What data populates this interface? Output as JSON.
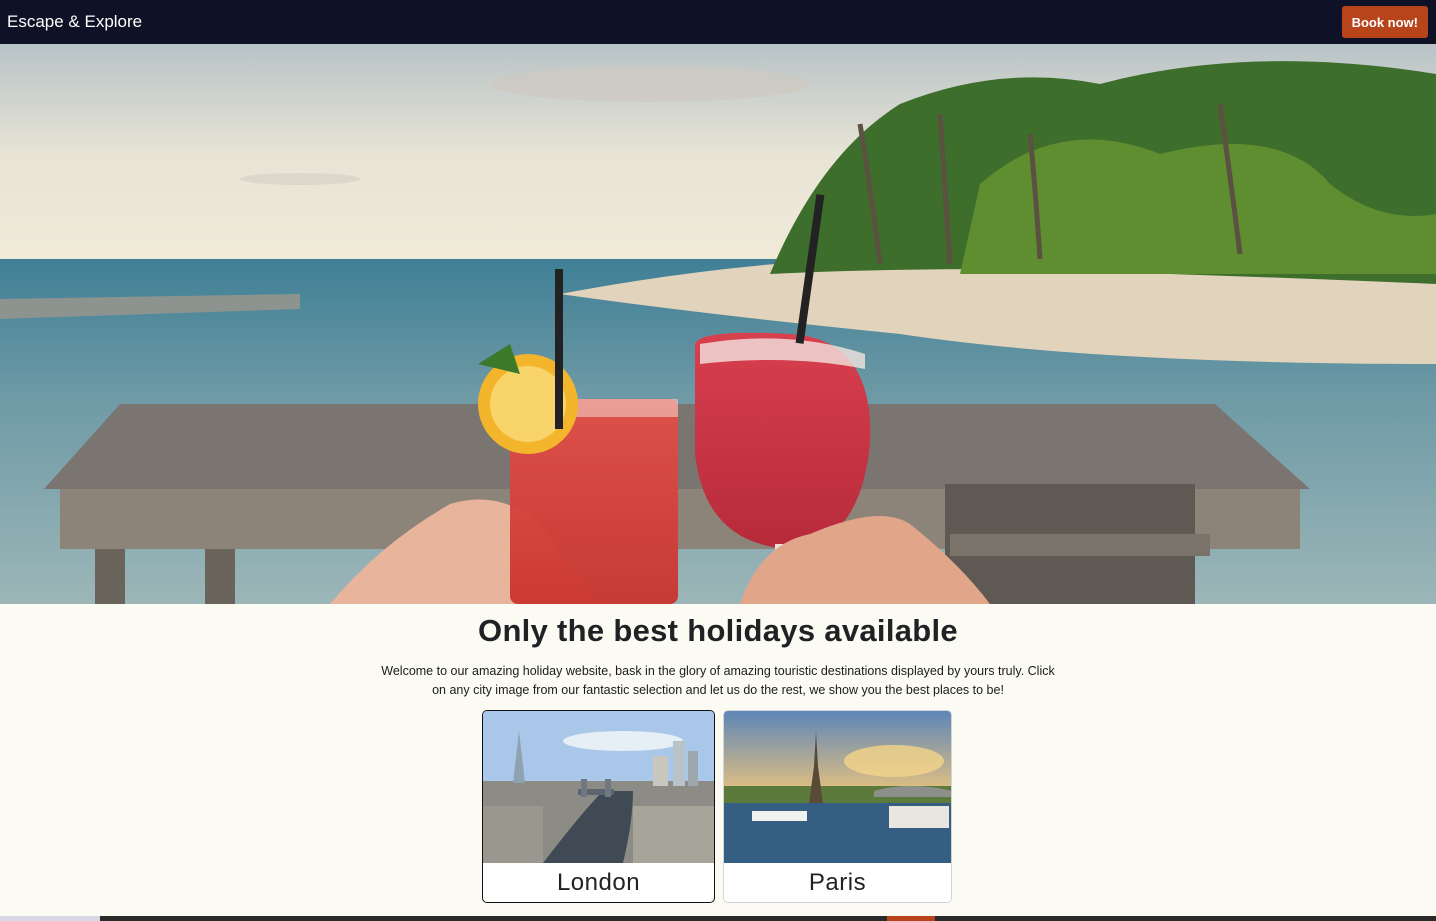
{
  "navbar": {
    "brand": "Escape & Explore",
    "cta_label": "Book now!"
  },
  "main": {
    "title": "Only the best holidays available",
    "intro": "Welcome to our amazing holiday website, bask in the glory of amazing touristic destinations displayed by yours truly. Click on any city image from our fantastic selection and let us do the rest, we show you the best places to be!"
  },
  "cities": [
    {
      "label": "London"
    },
    {
      "label": "Paris"
    }
  ],
  "colors": {
    "nav_bg": "#0f1226",
    "accent": "#b7441a",
    "page_bg": "#fbfaf3"
  }
}
